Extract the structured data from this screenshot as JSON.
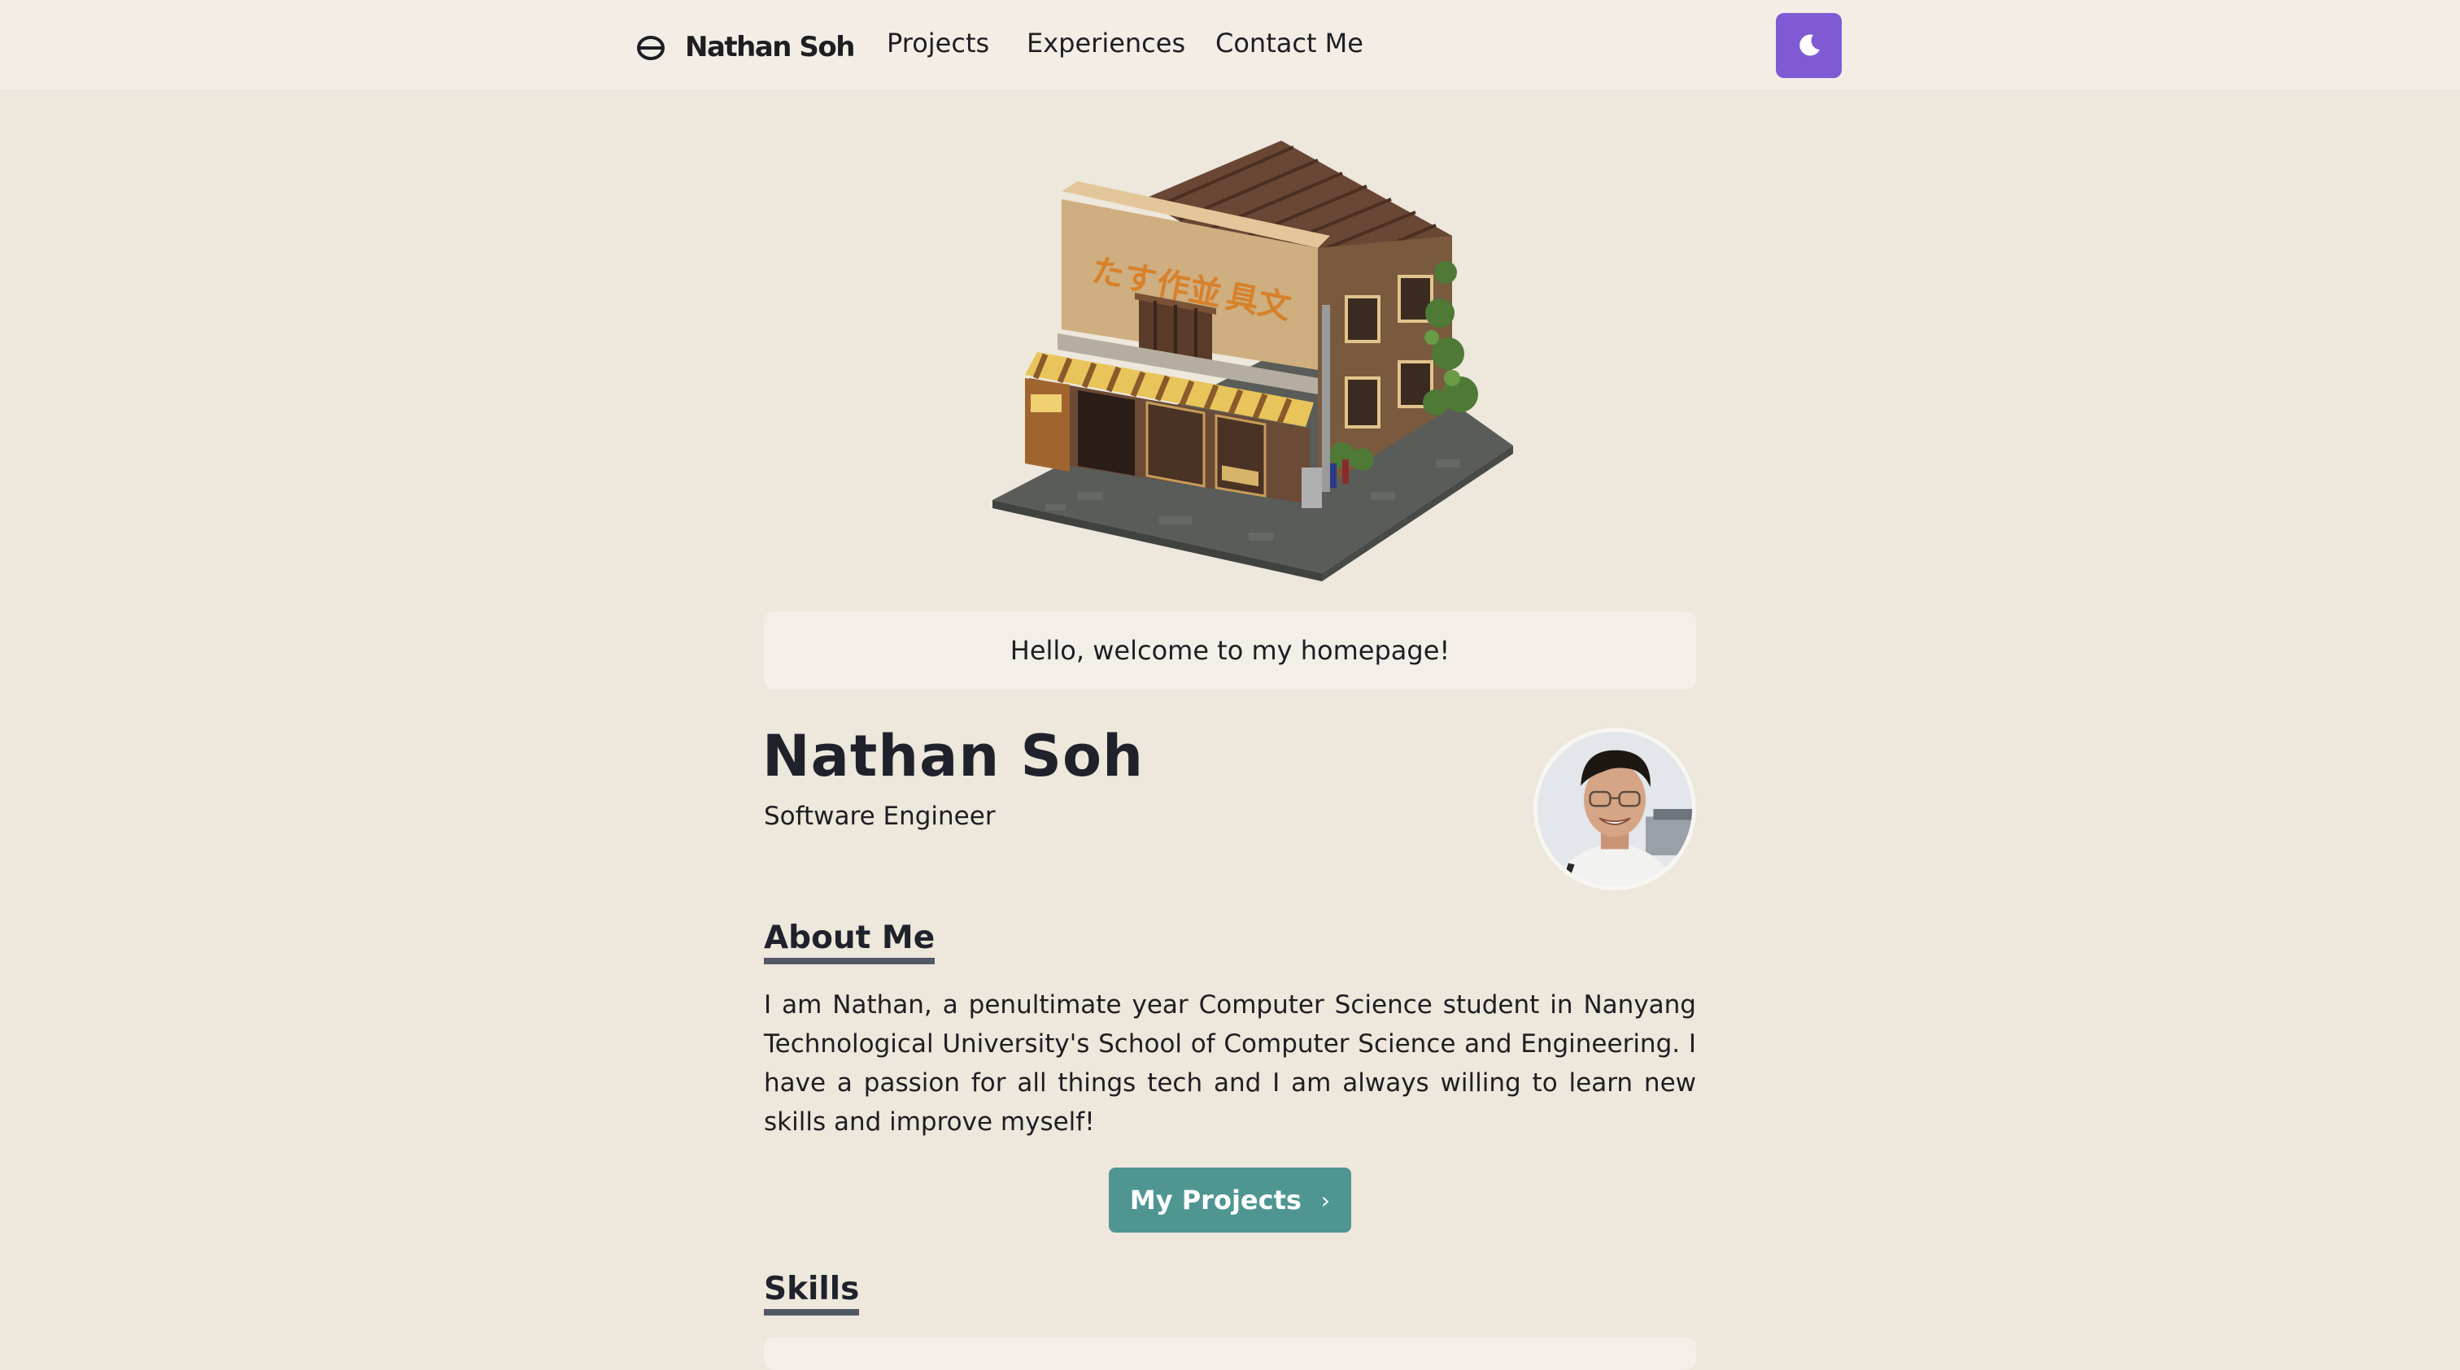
{
  "nav": {
    "logo_text": "Nathan Soh",
    "links": [
      "Projects",
      "Experiences",
      "Contact Me"
    ],
    "theme_toggle_icon": "moon-icon"
  },
  "colors": {
    "page_bg": "#ede7dc",
    "nav_bg": "#f4ede6",
    "accent_purple": "#805ad5",
    "button_teal": "#4f9693"
  },
  "hero": {
    "image": "voxel-shop-building",
    "welcome": "Hello, welcome to my homepage!"
  },
  "profile": {
    "name": "Nathan Soh",
    "title": "Software Engineer",
    "avatar": "profile-photo"
  },
  "about": {
    "heading": "About Me",
    "text": "I am Nathan, a penultimate year Computer Science student in Nanyang Technological University's School of Computer Science and Engineering. I have a passion for all things tech and I am always willing to learn new skills and improve myself!",
    "button_label": "My Projects",
    "button_icon": "chevron-right-icon"
  },
  "skills": {
    "heading": "Skills"
  }
}
